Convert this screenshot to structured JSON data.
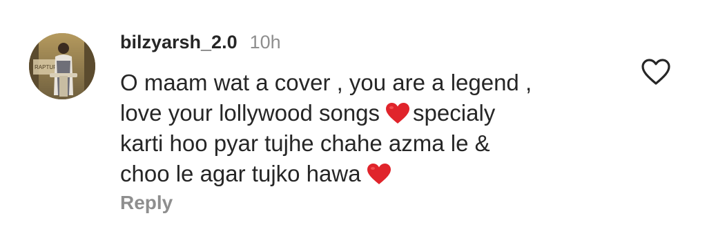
{
  "comment": {
    "username": "bilzyarsh_2.0",
    "timestamp": "10h",
    "text_lines": [
      "O maam wat a cover , you are a legend ,",
      "love your lollywood songs",
      "specialy",
      "karti hoo pyar tujhe chahe azma le &",
      "choo le agar tujko hawa"
    ],
    "reply_label": "Reply",
    "avatar_sign_text": "RAPTURE"
  },
  "icons": {
    "like": "heart-outline-icon",
    "emoji": "red-heart-emoji"
  },
  "colors": {
    "text": "#262626",
    "muted": "#8e8e8e",
    "heart_emoji": "#e0242b"
  }
}
